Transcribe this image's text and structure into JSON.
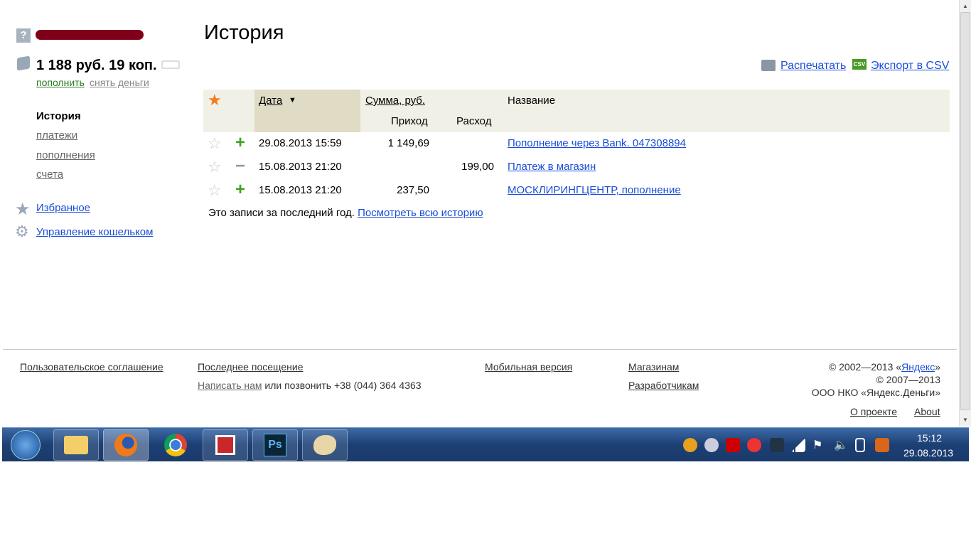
{
  "sidebar": {
    "balance": "1 188 руб. 19 коп.",
    "topup": "пополнить",
    "withdraw": "снять деньги",
    "current": "История",
    "links": [
      "платежи",
      "пополнения",
      "счета"
    ],
    "favorites": "Избранное",
    "manage": "Управление кошельком"
  },
  "main": {
    "title": "История",
    "print": "Распечатать",
    "export": "Экспорт в CSV",
    "csv_badge": "CSV",
    "headers": {
      "date": "Дата",
      "sort_arrow": "▼",
      "sum": "Сумма, руб.",
      "income": "Приход",
      "expense": "Расход",
      "name": "Название"
    },
    "rows": [
      {
        "type": "+",
        "date": "29.08.2013 15:59",
        "income": "1 149,69",
        "expense": "",
        "name": "Пополнение через Bank. 047308894"
      },
      {
        "type": "−",
        "date": "15.08.2013 21:20",
        "income": "",
        "expense": "199,00",
        "name": "Платеж в магазин"
      },
      {
        "type": "+",
        "date": "15.08.2013 21:20",
        "income": "237,50",
        "expense": "",
        "name": "МОСКЛИРИНГЦЕНТР, пополнение"
      }
    ],
    "note": "Это записи за последний год.",
    "all_history": "Посмотреть всю историю"
  },
  "footer": {
    "agreement": "Пользовательское соглашение",
    "last_visit": "Последнее посещение",
    "write_us": "Написать нам",
    "call": "или позвонить +38 (044) 364 4363",
    "mobile": "Мобильная версия",
    "shops": "Магазинам",
    "devs": "Разработчикам",
    "copy1": "© 2002—2013 «",
    "yandex": "Яндекс",
    "copy1_end": "»",
    "copy2": "© 2007—2013",
    "copy3": "ООО НКО «Яндекс.Деньги»",
    "about_ru": "О проекте",
    "about_en": "About"
  },
  "taskbar": {
    "time": "15:12",
    "date": "29.08.2013",
    "ps": "Ps"
  },
  "colors": {
    "link": "#1a4ed6",
    "plus": "#3aa61a",
    "header": "#f1f0e7",
    "date_col": "#e0dbc5"
  }
}
